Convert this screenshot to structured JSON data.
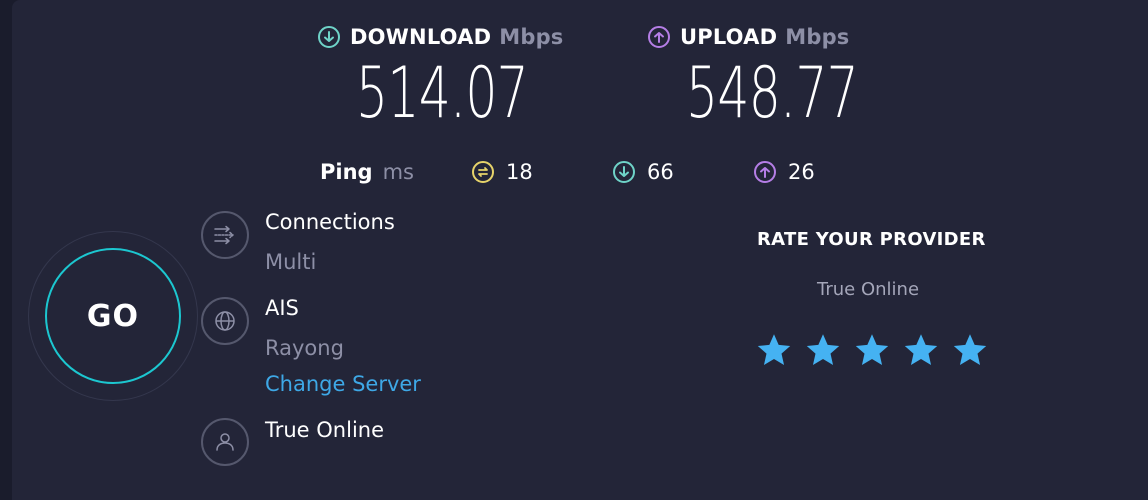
{
  "download": {
    "label": "DOWNLOAD",
    "unit": "Mbps",
    "value": "514.07",
    "color": "#6fd3c8"
  },
  "upload": {
    "label": "UPLOAD",
    "unit": "Mbps",
    "value": "548.77",
    "color": "#b57ee6"
  },
  "ping": {
    "label": "Ping",
    "unit": "ms",
    "idle": {
      "value": "18",
      "icon": "jitter-icon",
      "color": "#e6d36a"
    },
    "download": {
      "value": "66",
      "icon": "arrow-down-icon",
      "color": "#6fd3c8"
    },
    "upload": {
      "value": "26",
      "icon": "arrow-up-icon",
      "color": "#b57ee6"
    }
  },
  "go_button": {
    "label": "GO",
    "ring_color": "#1cc7d0"
  },
  "connections": {
    "title": "Connections",
    "value": "Multi",
    "icon": "connections-icon"
  },
  "server": {
    "name": "AIS",
    "location": "Rayong",
    "change_label": "Change Server",
    "icon": "globe-icon"
  },
  "provider": {
    "name": "True Online",
    "icon": "person-icon"
  },
  "rating": {
    "title": "RATE YOUR PROVIDER",
    "provider": "True Online",
    "stars": 5,
    "star_color": "#45b2f2"
  }
}
